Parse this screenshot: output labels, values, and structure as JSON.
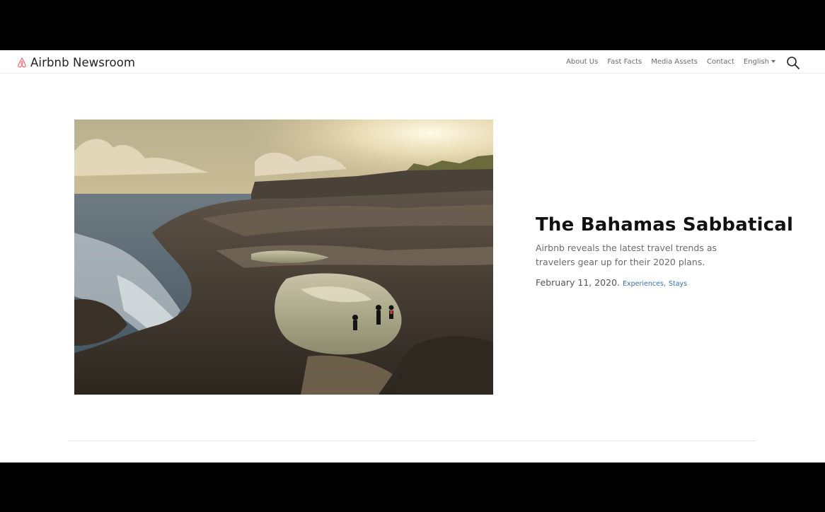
{
  "brand": {
    "name": "Airbnb Newsroom",
    "logo_icon": "airbnb-belo-icon",
    "accent": "#FF5A5F"
  },
  "nav": {
    "links": [
      "About Us",
      "Fast Facts",
      "Media Assets",
      "Contact"
    ],
    "language": "English",
    "search_icon": "search-icon"
  },
  "featured": {
    "image_icon": "bahamas-coast-photo",
    "title": "The Bahamas Sabbatical",
    "subtitle": "Airbnb reveals the latest travel trends as travelers gear up for their 2020 plans.",
    "date": "February 11, 2020.",
    "tags": [
      "Experiences",
      "Stays"
    ]
  }
}
